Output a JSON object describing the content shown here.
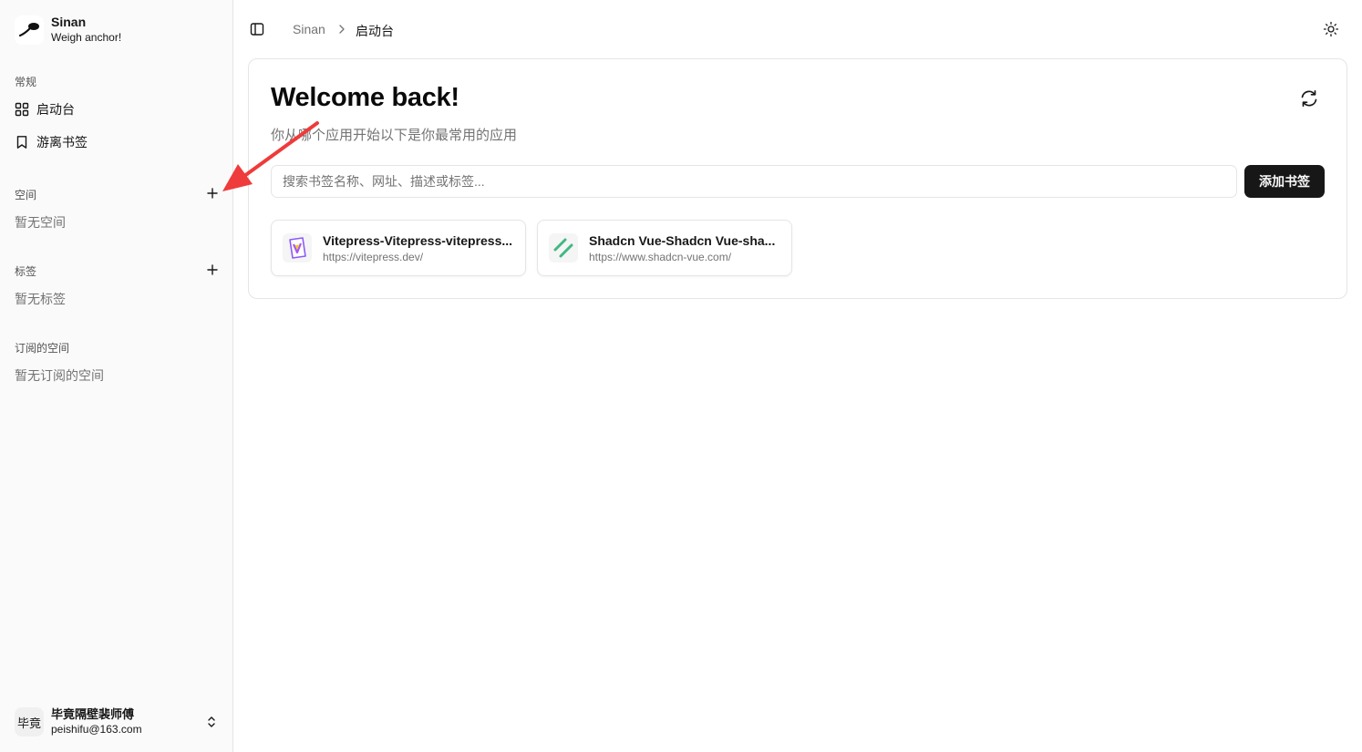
{
  "brand": {
    "name": "Sinan",
    "tagline": "Weigh anchor!"
  },
  "sidebar": {
    "general_label": "常规",
    "nav": [
      {
        "label": "启动台",
        "icon": "grid-icon"
      },
      {
        "label": "游离书签",
        "icon": "bookmark-icon"
      }
    ],
    "spaces": {
      "label": "空间",
      "empty": "暂无空间"
    },
    "tags": {
      "label": "标签",
      "empty": "暂无标签"
    },
    "subscribed": {
      "label": "订阅的空间",
      "empty": "暂无订阅的空间"
    }
  },
  "user": {
    "avatar_text": "毕竟",
    "name": "毕竟隔壁裴师傅",
    "email": "peishifu@163.com"
  },
  "header": {
    "breadcrumb_root": "Sinan",
    "breadcrumb_current": "启动台"
  },
  "main": {
    "title": "Welcome back!",
    "subtitle": "你从哪个应用开始以下是你最常用的应用",
    "search_placeholder": "搜索书签名称、网址、描述或标签...",
    "add_button": "添加书签",
    "bookmarks": [
      {
        "title": "Vitepress-Vitepress-vitepress...",
        "url": "https://vitepress.dev/"
      },
      {
        "title": "Shadcn Vue-Shadcn Vue-sha...",
        "url": "https://www.shadcn-vue.com/"
      }
    ]
  },
  "colors": {
    "accent": "#171717",
    "annotation_arrow": "#ef3b3b",
    "muted_text": "#737373"
  }
}
